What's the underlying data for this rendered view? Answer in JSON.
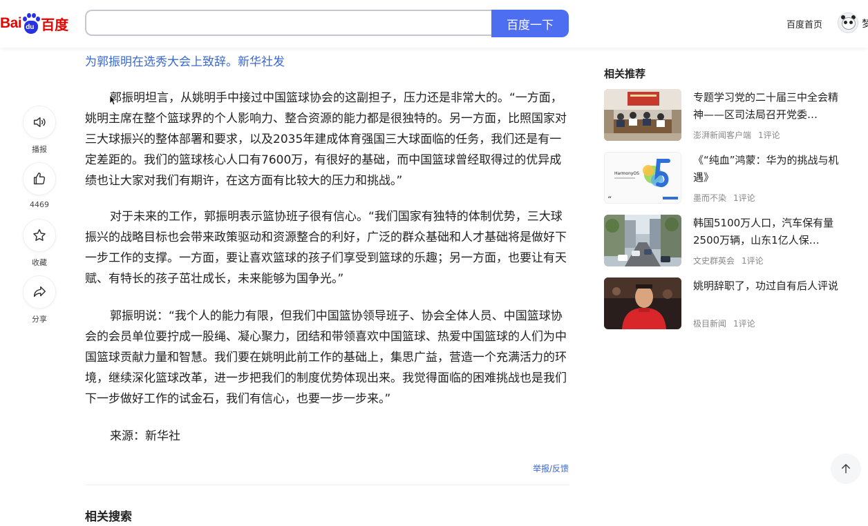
{
  "header": {
    "logo_bai": "Bai",
    "logo_paw_text": "du",
    "logo_du": "百度",
    "search_value": "",
    "search_button": "百度一下",
    "home_link": "百度首页",
    "user_name_clip": "梦"
  },
  "rail": {
    "broadcast_label": "播报",
    "like_count": "4469",
    "favorite_label": "收藏",
    "share_label": "分享"
  },
  "article": {
    "caption": "为郭振明在选秀大会上致辞。新华社发",
    "paragraphs": [
      "郭振明坦言，从姚明手中接过中国篮球协会的这副担子，压力还是非常大的。“一方面，姚明主席在整个篮球界的个人影响力、整合资源的能力都是很独特的。另一方面，比照国家对三大球振兴的整体部署和要求，以及2035年建成体育强国三大球面临的任务，我们还是有一定差距的。我们的篮球核心人口有7600万，有很好的基础，而中国篮球曾经取得过的优异成绩也让大家对我们有期许，在这方面有比较大的压力和挑战。”",
      "对于未来的工作，郭振明表示篮协班子很有信心。“我们国家有独特的体制优势，三大球振兴的战略目标也会带来政策驱动和资源整合的利好，广泛的群众基础和人才基础将是做好下一步工作的支撑。一方面，要让喜欢篮球的孩子们享受到篮球的乐趣；另一方面，也要让有天赋、有特长的孩子茁壮成长，未来能够为国争光。”",
      "郭振明说：“我个人的能力有限，但我们中国篮协领导班子、协会全体人员、中国篮球协会的会员单位要拧成一股绳、凝心聚力，团结和带领喜欢中国篮球、热爱中国篮球的人们为中国篮球贡献力量和智慧。我们要在姚明此前工作的基础上，集思广益，营造一个充满活力的环境，继续深化篮球改革，进一步把我们的制度优势体现出来。我觉得面临的困难挑战也是我们下一步做好工作的试金石，我们有信心，也要一步一步来。”",
      "来源：新华社"
    ],
    "report_link": "举报/反馈",
    "related_search_title": "相关搜索"
  },
  "sidebar": {
    "title": "相关推荐",
    "items": [
      {
        "title": "专题学习党的二十届三中全会精神——区司法局召开党委…",
        "source": "澎湃新闻客户端",
        "comments": "1评论"
      },
      {
        "title": "《“纯血”鸿蒙：华为的挑战与机遇》",
        "source": "墨而不染",
        "comments": "1评论",
        "thumb_label": "HarmonyOS"
      },
      {
        "title": "韩国5100万人口，汽车保有量2500万辆，山东1亿人保…",
        "source": "文史群英会",
        "comments": "1评论"
      },
      {
        "title": "姚明辞职了，功过自有后人评说",
        "source": "极目新闻",
        "comments": "1评论"
      }
    ]
  },
  "colors": {
    "brand_red": "#e10601",
    "brand_blue": "#2932e1",
    "search_button": "#4e6ef2",
    "link_blue": "#3a68d2"
  }
}
